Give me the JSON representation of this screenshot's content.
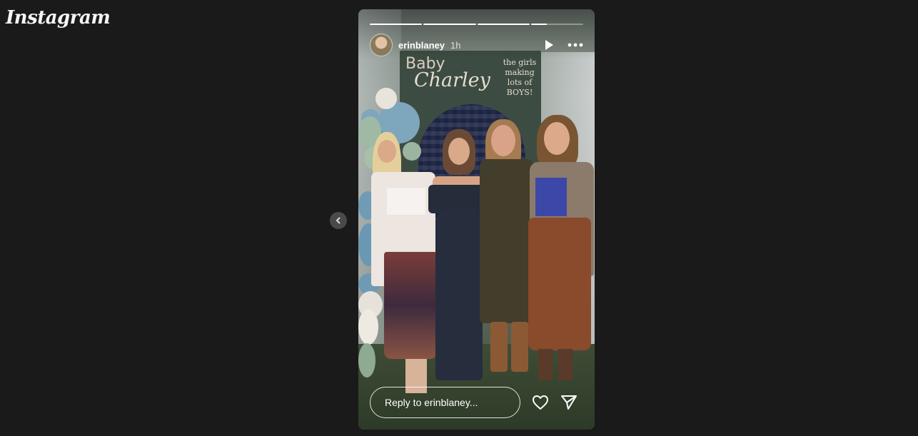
{
  "app": {
    "logo_text": "Instagram"
  },
  "nav": {
    "prev_icon": "chevron-left-icon"
  },
  "story": {
    "progress_segments": [
      1,
      1,
      1,
      0.3
    ],
    "user": {
      "username": "erinblaney",
      "time": "1h"
    },
    "controls": {
      "play_icon": "play-icon",
      "more_icon": "more-horizontal-icon"
    },
    "image": {
      "backdrop_line1": "Baby",
      "backdrop_line2": "Charley",
      "backdrop_note": "the girls making lots of BOYS!"
    },
    "reply_placeholder": "Reply to erinblaney...",
    "like_icon": "heart-icon",
    "share_icon": "send-icon"
  }
}
